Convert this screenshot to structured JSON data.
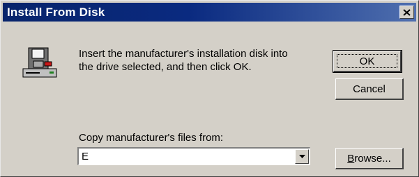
{
  "window": {
    "title": "Install From Disk"
  },
  "message": {
    "line1": "Insert the manufacturer's installation disk into",
    "line2": "the drive selected, and then click OK."
  },
  "buttons": {
    "ok": "OK",
    "cancel": "Cancel",
    "browse_mnemonic": "B",
    "browse_rest": "rowse..."
  },
  "copy_from": {
    "label": "Copy manufacturer's files from:",
    "value": "E"
  },
  "icons": {
    "dialog": "disk-drive-icon",
    "close": "close-icon",
    "dropdown": "chevron-down-icon"
  },
  "colors": {
    "titlebar_start": "#08246b",
    "titlebar_end": "#4f6faf",
    "face": "#d4d0c8"
  }
}
